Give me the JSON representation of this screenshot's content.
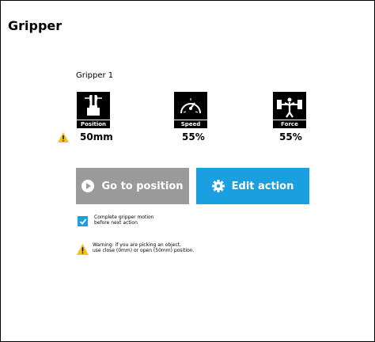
{
  "title": "Gripper",
  "gripper_label": "Gripper 1",
  "metrics": {
    "position": {
      "label": "Position",
      "value": "50mm"
    },
    "speed": {
      "label": "Speed",
      "value": "55%"
    },
    "force": {
      "label": "Force",
      "value": "55%"
    }
  },
  "buttons": {
    "go_to_position": "Go to position",
    "edit_action": "Edit action"
  },
  "options": {
    "complete_motion_label_1": "Complete gripper motion",
    "complete_motion_label_2": "before next action",
    "complete_motion_checked": true
  },
  "warning": {
    "line1": "Warning: if you are picking an object,",
    "line2": "use close (0mm) or open (50mm) position."
  },
  "colors": {
    "accent": "#1a9fe0",
    "button_disabled": "#9a9a9a",
    "warning": "#f5c21b"
  },
  "icons": [
    "position-icon",
    "speed-icon",
    "force-icon",
    "warning-icon",
    "play-icon",
    "gear-icon",
    "check-icon"
  ]
}
